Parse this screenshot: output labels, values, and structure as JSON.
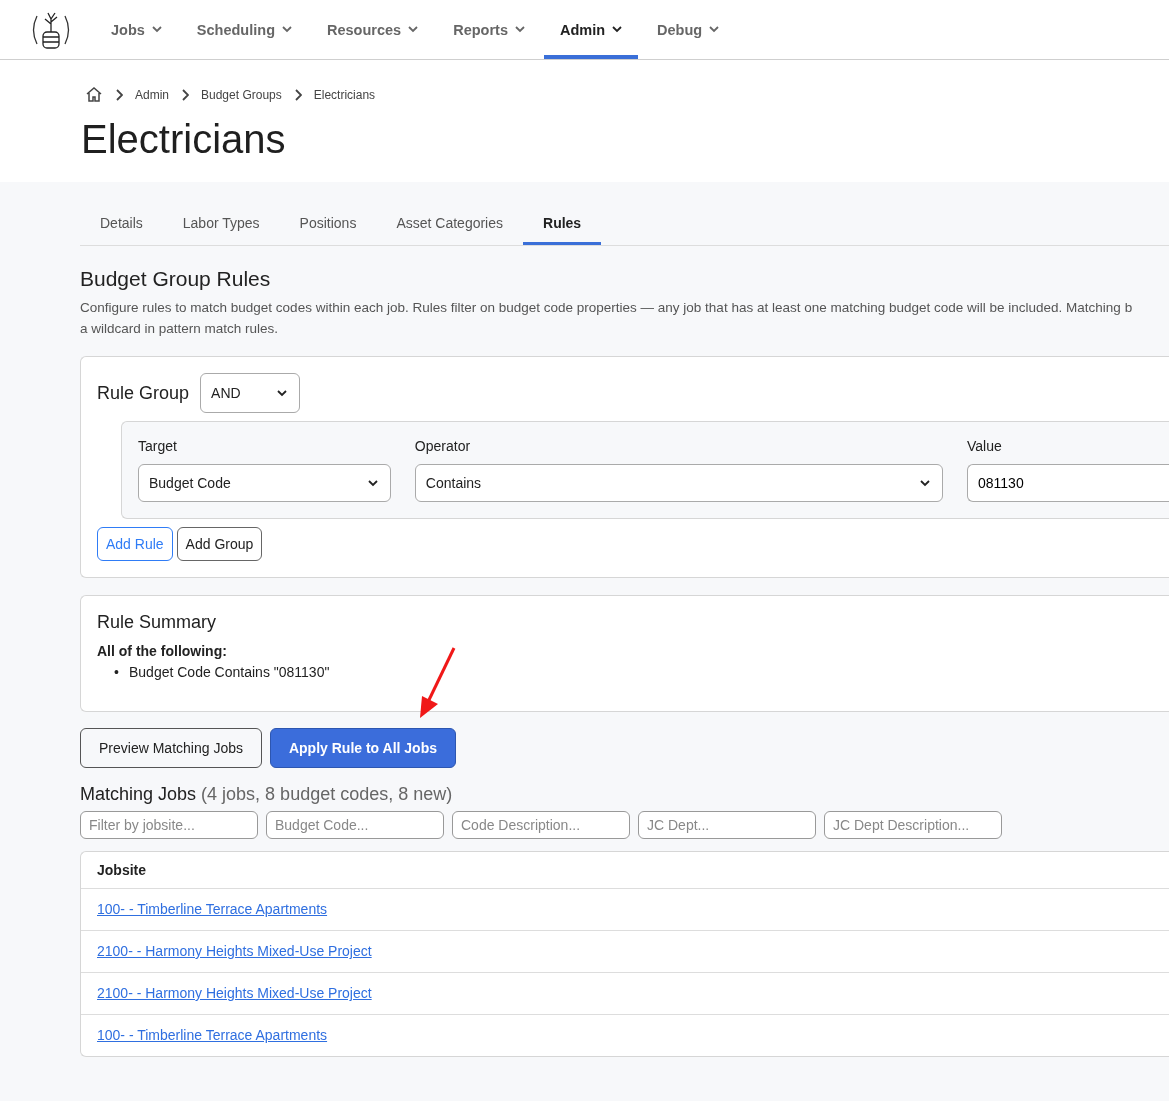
{
  "nav": {
    "items": [
      {
        "label": "Jobs",
        "selected": false
      },
      {
        "label": "Scheduling",
        "selected": false
      },
      {
        "label": "Resources",
        "selected": false
      },
      {
        "label": "Reports",
        "selected": false
      },
      {
        "label": "Admin",
        "selected": true
      },
      {
        "label": "Debug",
        "selected": false
      }
    ]
  },
  "breadcrumbs": [
    "Admin",
    "Budget Groups",
    "Electricians"
  ],
  "page_title": "Electricians",
  "tabs": [
    {
      "label": "Details",
      "selected": false
    },
    {
      "label": "Labor Types",
      "selected": false
    },
    {
      "label": "Positions",
      "selected": false
    },
    {
      "label": "Asset Categories",
      "selected": false
    },
    {
      "label": "Rules",
      "selected": true
    }
  ],
  "section_title": "Budget Group Rules",
  "description_lines": [
    "Configure rules to match budget codes within each job. Rules filter on budget code properties — any job that has at least one matching budget code will be included. Matching b",
    "a wildcard in pattern match rules."
  ],
  "rule_group": {
    "label": "Rule Group",
    "operator": "AND",
    "rule": {
      "target_label": "Target",
      "target": "Budget Code",
      "operator_label": "Operator",
      "operator": "Contains",
      "value_label": "Value",
      "value": "081130"
    },
    "buttons": [
      "Add Rule",
      "Add Group"
    ]
  },
  "summary": {
    "title": "Rule Summary",
    "heading": "All of the following:",
    "items": [
      {
        "bullet": "•",
        "text": "Budget Code Contains \"081130\""
      }
    ]
  },
  "actions": [
    {
      "label": "Preview Matching Jobs",
      "kind": "secondary"
    },
    {
      "label": "Apply Rule to All Jobs",
      "kind": "primary"
    }
  ],
  "matching": {
    "title": "Matching Jobs",
    "count": "(4 jobs, 8 budget codes, 8 new)",
    "filters": [
      {
        "placeholder": "Filter by jobsite..."
      },
      {
        "placeholder": "Budget Code..."
      },
      {
        "placeholder": "Code Description..."
      },
      {
        "placeholder": "JC Dept..."
      },
      {
        "placeholder": "JC Dept Description..."
      }
    ],
    "column": "Jobsite",
    "rows": [
      "100- - Timberline Terrace Apartments",
      "2100- - Harmony Heights Mixed-Use Project",
      "2100- - Harmony Heights Mixed-Use Project",
      "100- - Timberline Terrace Apartments"
    ]
  }
}
